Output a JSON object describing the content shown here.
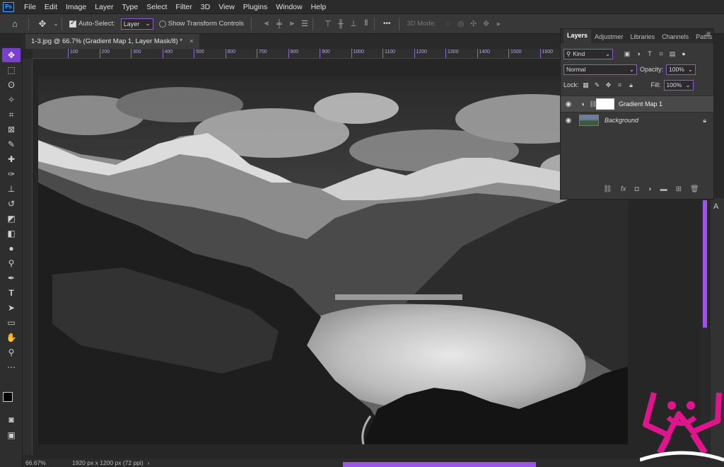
{
  "menu": [
    "File",
    "Edit",
    "Image",
    "Layer",
    "Type",
    "Select",
    "Filter",
    "3D",
    "View",
    "Plugins",
    "Window",
    "Help"
  ],
  "app_logo": "Ps",
  "options": {
    "auto_select_label": "Auto-Select:",
    "auto_select_value": "Layer",
    "show_transform_label": "Show Transform Controls",
    "mode_3d_label": "3D Mode:",
    "more": "•••"
  },
  "document": {
    "tab_title": "1-3.jpg @ 66.7% (Gradient Map 1, Layer Mask/8) *",
    "close": "×",
    "zoom": "66.67%",
    "doc_info": "1920 px x 1200 px (72 ppi)",
    "arrow": "›"
  },
  "ruler_labels": [
    "100",
    "200",
    "300",
    "400",
    "500",
    "600",
    "700",
    "800",
    "900",
    "1000",
    "1100",
    "1200",
    "1300",
    "1400",
    "1500",
    "1600"
  ],
  "layers_panel": {
    "tabs": [
      "Layers",
      "Adjustmer",
      "Libraries",
      "Channels",
      "Paths"
    ],
    "filter_kind": "Kind",
    "blend_mode": "Normal",
    "opacity_label": "Opacity:",
    "opacity_value": "100%",
    "lock_label": "Lock:",
    "fill_label": "Fill:",
    "fill_value": "100%",
    "layers": [
      {
        "name": "Gradient Map 1",
        "type": "adjustment",
        "selected": true
      },
      {
        "name": "Background",
        "type": "image",
        "locked": true,
        "italic": true
      }
    ],
    "footer_icons": [
      "link-icon",
      "fx-icon",
      "mask-icon",
      "adjustment-icon",
      "folder-icon",
      "new-layer-icon",
      "trash-icon"
    ],
    "footer_fx": "fx"
  },
  "colors": {
    "accent": "#9b55e8",
    "brand": "#e0148c"
  }
}
